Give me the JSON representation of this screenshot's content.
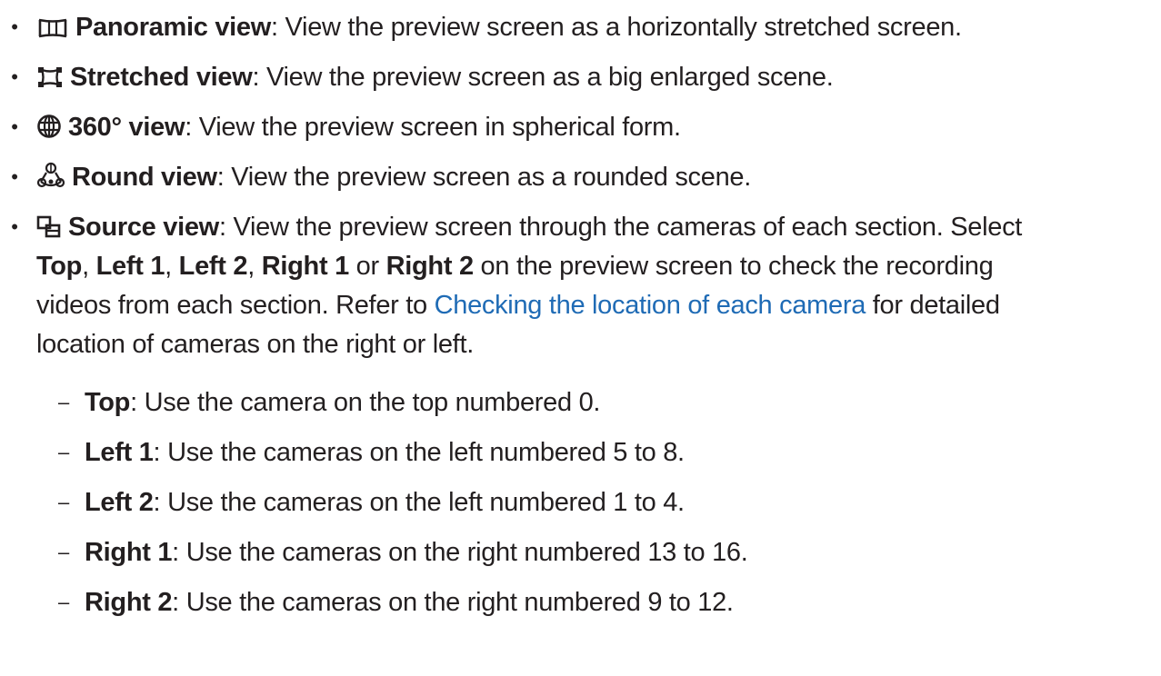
{
  "items": [
    {
      "icon": "panoramic-view-icon",
      "term": "Panoramic view",
      "sep": ": ",
      "desc": "View the preview screen as a horizontally stretched screen."
    },
    {
      "icon": "stretched-view-icon",
      "term": "Stretched view",
      "sep": ": ",
      "desc": "View the preview screen as a big enlarged scene."
    },
    {
      "icon": "360-view-icon",
      "term": "360° view",
      "sep": ": ",
      "desc": "View the preview screen in spherical form."
    },
    {
      "icon": "round-view-icon",
      "term": "Round view",
      "sep": ": ",
      "desc": "View the preview screen as a rounded scene."
    },
    {
      "icon": "source-view-icon",
      "term": "Source view",
      "sep": ": ",
      "desc_l1": "View the preview screen through the cameras of each section. Select",
      "l2": {
        "top": "Top",
        "c1": ", ",
        "left1": "Left 1",
        "c2": ", ",
        "left2": "Left 2",
        "c3": ", ",
        "right1": "Right 1",
        "or": " or ",
        "right2": "Right 2",
        "rest": " on the preview screen to check the recording"
      },
      "l3": {
        "pre": "videos from each section. Refer to ",
        "link": "Checking the location of each camera",
        "post": " for detailed"
      },
      "l4": "location of cameras on the right or left."
    }
  ],
  "bullet_char": "•",
  "dash_char": "–",
  "subitems": [
    {
      "term": "Top",
      "sep": ": ",
      "desc": "Use the camera on the top numbered 0."
    },
    {
      "term": "Left 1",
      "sep": ": ",
      "desc": "Use the cameras on the left numbered 5 to 8."
    },
    {
      "term": "Left 2",
      "sep": ": ",
      "desc": "Use the cameras on the left numbered 1 to 4."
    },
    {
      "term": "Right 1",
      "sep": ": ",
      "desc": "Use the cameras on the right numbered 13 to 16."
    },
    {
      "term": "Right 2",
      "sep": ": ",
      "desc": "Use the cameras on the right numbered 9 to 12."
    }
  ],
  "colors": {
    "text": "#231f20",
    "link": "#1f6bb5"
  }
}
